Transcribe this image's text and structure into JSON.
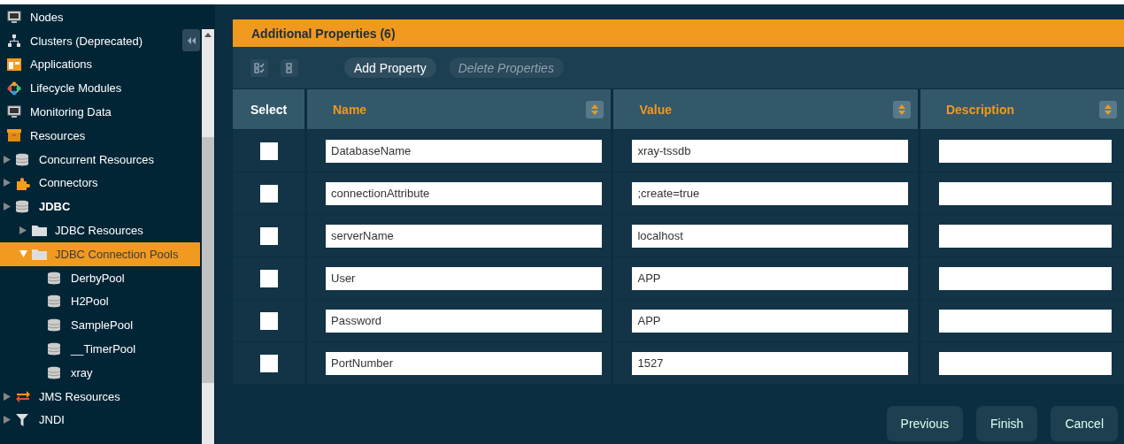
{
  "sidebar": {
    "items": [
      {
        "label": "Nodes",
        "kind": "monitor",
        "bold": false,
        "selected": false
      },
      {
        "label": "Clusters (Deprecated)",
        "kind": "cluster",
        "bold": false,
        "selected": false
      },
      {
        "label": "Applications",
        "kind": "app",
        "bold": false,
        "selected": false
      },
      {
        "label": "Lifecycle Modules",
        "kind": "lifecycle",
        "bold": false,
        "selected": false
      },
      {
        "label": "Monitoring Data",
        "kind": "monitor",
        "bold": false,
        "selected": false
      },
      {
        "label": "Resources",
        "kind": "box",
        "bold": false,
        "selected": false,
        "children": [
          {
            "label": "Concurrent Resources",
            "kind": "db",
            "bold": false,
            "selected": false,
            "expanded": false
          },
          {
            "label": "Connectors",
            "kind": "puzzle",
            "bold": false,
            "selected": false,
            "expanded": false
          },
          {
            "label": "JDBC",
            "kind": "db",
            "bold": true,
            "selected": false,
            "expanded": false,
            "children": [
              {
                "label": "JDBC Resources",
                "kind": "folder",
                "bold": false,
                "selected": false,
                "expanded": false
              },
              {
                "label": "JDBC Connection Pools",
                "kind": "folder",
                "bold": false,
                "selected": true,
                "expanded": true,
                "children": [
                  {
                    "label": "DerbyPool",
                    "kind": "db",
                    "bold": false,
                    "selected": false
                  },
                  {
                    "label": "H2Pool",
                    "kind": "db",
                    "bold": false,
                    "selected": false
                  },
                  {
                    "label": "SamplePool",
                    "kind": "db",
                    "bold": false,
                    "selected": false
                  },
                  {
                    "label": "__TimerPool",
                    "kind": "db",
                    "bold": false,
                    "selected": false
                  },
                  {
                    "label": "xray",
                    "kind": "db",
                    "bold": false,
                    "selected": false
                  }
                ]
              }
            ]
          },
          {
            "label": "JMS Resources",
            "kind": "arrows",
            "bold": false,
            "selected": false,
            "expanded": false
          },
          {
            "label": "JNDI",
            "kind": "filter",
            "bold": false,
            "selected": false,
            "expanded": false
          }
        ]
      }
    ]
  },
  "panel": {
    "title": "Additional Properties (6)",
    "toolbar": [
      {
        "label": "Add Property",
        "disabled": false
      },
      {
        "label": "Delete Properties",
        "disabled": true
      }
    ],
    "table": {
      "columns": [
        {
          "label": "Select",
          "sortable": false
        },
        {
          "label": "Name",
          "sortable": true
        },
        {
          "label": "Value",
          "sortable": true
        },
        {
          "label": "Description",
          "sortable": true
        }
      ],
      "rows": [
        {
          "checked": false,
          "name": "DatabaseName",
          "value": "xray-tssdb"
        },
        {
          "checked": false,
          "name": "connectionAttribute",
          "value": ";create=true"
        },
        {
          "checked": false,
          "name": "serverName",
          "value": "localhost"
        },
        {
          "checked": false,
          "name": "User",
          "value": "APP"
        },
        {
          "checked": false,
          "name": "Password",
          "value": "APP"
        },
        {
          "checked": false,
          "name": "PortNumber",
          "value": "1527"
        }
      ]
    }
  },
  "buttons": [
    "Previous",
    "Finish",
    "Cancel"
  ]
}
